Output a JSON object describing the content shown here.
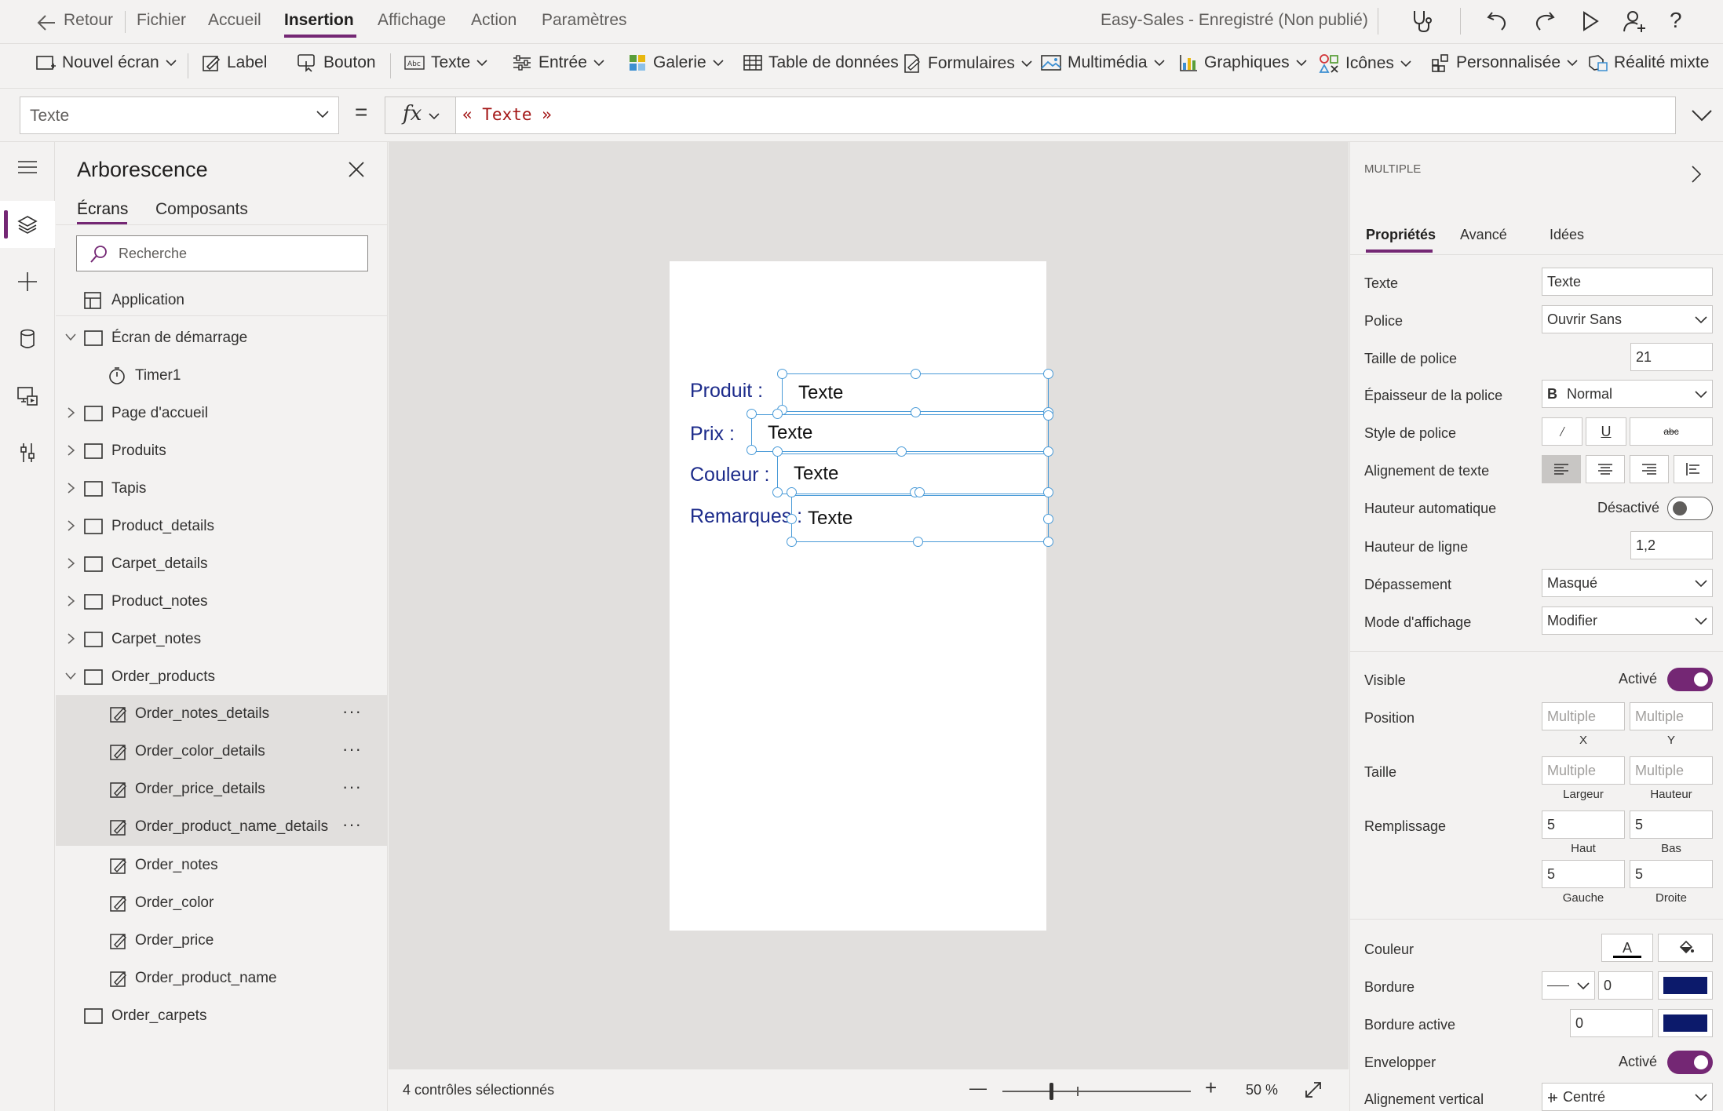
{
  "menubar": {
    "back_label": "Retour",
    "items": [
      "Fichier",
      "Accueil",
      "Insertion",
      "Affichage",
      "Action",
      "Paramètres"
    ],
    "app_status": "Easy-Sales - Enregistré (Non publié)"
  },
  "ribbon": {
    "new_screen": "Nouvel écran",
    "label": "Label",
    "button": "Bouton",
    "text": "Texte",
    "input": "Entrée",
    "gallery": "Galerie",
    "data_table": "Table de données",
    "forms": "Formulaires",
    "media": "Multimédia",
    "charts": "Graphiques",
    "icons": "Icônes",
    "custom": "Personnalisée",
    "mixed_reality": "Réalité mixte"
  },
  "formula": {
    "property": "Texte",
    "equals": "=",
    "fx": "fx",
    "value": "« Texte »"
  },
  "tree": {
    "title": "Arborescence",
    "tabs": [
      "Écrans",
      "Composants"
    ],
    "search_placeholder": "Recherche",
    "items": [
      {
        "label": "Application"
      },
      {
        "label": "Écran de démarrage"
      },
      {
        "label": "Timer1"
      },
      {
        "label": "Page d'accueil"
      },
      {
        "label": "Produits"
      },
      {
        "label": "Tapis"
      },
      {
        "label": "Product_details"
      },
      {
        "label": "Carpet_details"
      },
      {
        "label": "Product_notes"
      },
      {
        "label": "Carpet_notes"
      },
      {
        "label": "Order_products"
      },
      {
        "label": "Order_notes_details"
      },
      {
        "label": "Order_color_details"
      },
      {
        "label": "Order_price_details"
      },
      {
        "label": "Order_product_name_details"
      },
      {
        "label": "Order_notes"
      },
      {
        "label": "Order_color"
      },
      {
        "label": "Order_price"
      },
      {
        "label": "Order_product_name"
      },
      {
        "label": "Order_carpets"
      }
    ],
    "more": "···"
  },
  "canvas": {
    "labels": [
      "Produit :",
      "Prix :",
      "Couleur :",
      "Remarques :"
    ],
    "inputs": [
      "Texte",
      "Texte",
      "Texte",
      "Texte"
    ]
  },
  "status": {
    "selection": "4 contrôles sélectionnés",
    "zoom": "50 %",
    "minus": "—",
    "plus": "+"
  },
  "props": {
    "header": "MULTIPLE",
    "tabs": [
      "Propriétés",
      "Avancé",
      "Idées"
    ],
    "text_label": "Texte",
    "text_value": "Texte",
    "font_label": "Police",
    "font_value": "Ouvrir Sans",
    "font_size_label": "Taille de police",
    "font_size_value": "21",
    "font_weight_label": "Épaisseur de la police",
    "font_weight_prefix": "B",
    "font_weight_value": "Normal",
    "font_style_label": "Style de police",
    "align_label": "Alignement de texte",
    "autoheight_label": "Hauteur automatique",
    "autoheight_value": "Désactivé",
    "line_height_label": "Hauteur de ligne",
    "line_height_value": "1,2",
    "overflow_label": "Dépassement",
    "overflow_value": "Masqué",
    "display_mode_label": "Mode d'affichage",
    "display_mode_value": "Modifier",
    "visible_label": "Visible",
    "visible_value": "Activé",
    "position_label": "Position",
    "position_x": "Multiple",
    "position_y": "Multiple",
    "x": "X",
    "y": "Y",
    "size_label": "Taille",
    "width_value": "Multiple",
    "height_value": "Multiple",
    "width": "Largeur",
    "height": "Hauteur",
    "padding_label": "Remplissage",
    "pad_top": "5",
    "pad_bottom": "5",
    "pad_left": "5",
    "pad_right": "5",
    "top": "Haut",
    "bottom": "Bas",
    "left": "Gauche",
    "right": "Droite",
    "color_label": "Couleur",
    "color_letter": "A",
    "border_label": "Bordure",
    "border_value": "0",
    "focus_border_label": "Bordure active",
    "focus_border_value": "0",
    "wrap_label": "Envelopper",
    "wrap_value": "Activé",
    "valign_label": "Alignement vertical",
    "valign_value": "Centré",
    "border_color": "#0c1a6b",
    "accent": "#742774"
  }
}
